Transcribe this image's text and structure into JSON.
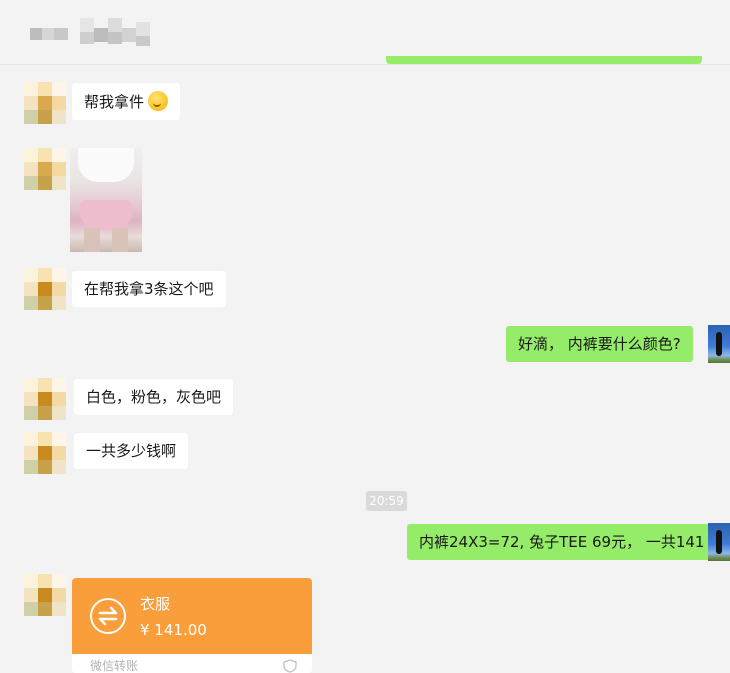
{
  "messages": {
    "m1": "帮我拿件",
    "m2": "在帮我拿3条这个吧",
    "m3": "好滴， 内裤要什么颜色?",
    "m4": "白色，粉色，灰色吧",
    "m5": "一共多少钱啊",
    "m6": "内裤24X3=72, 兔子TEE 69元， 一共141"
  },
  "timestamp": "20:59",
  "transfer": {
    "title": "衣服",
    "amount": "¥ 141.00",
    "footer": "微信转账"
  },
  "colors": {
    "sent_bubble": "#95ec69",
    "received_bubble": "#ffffff",
    "transfer_card": "#fa9d3b",
    "background": "#f3f3f3"
  }
}
